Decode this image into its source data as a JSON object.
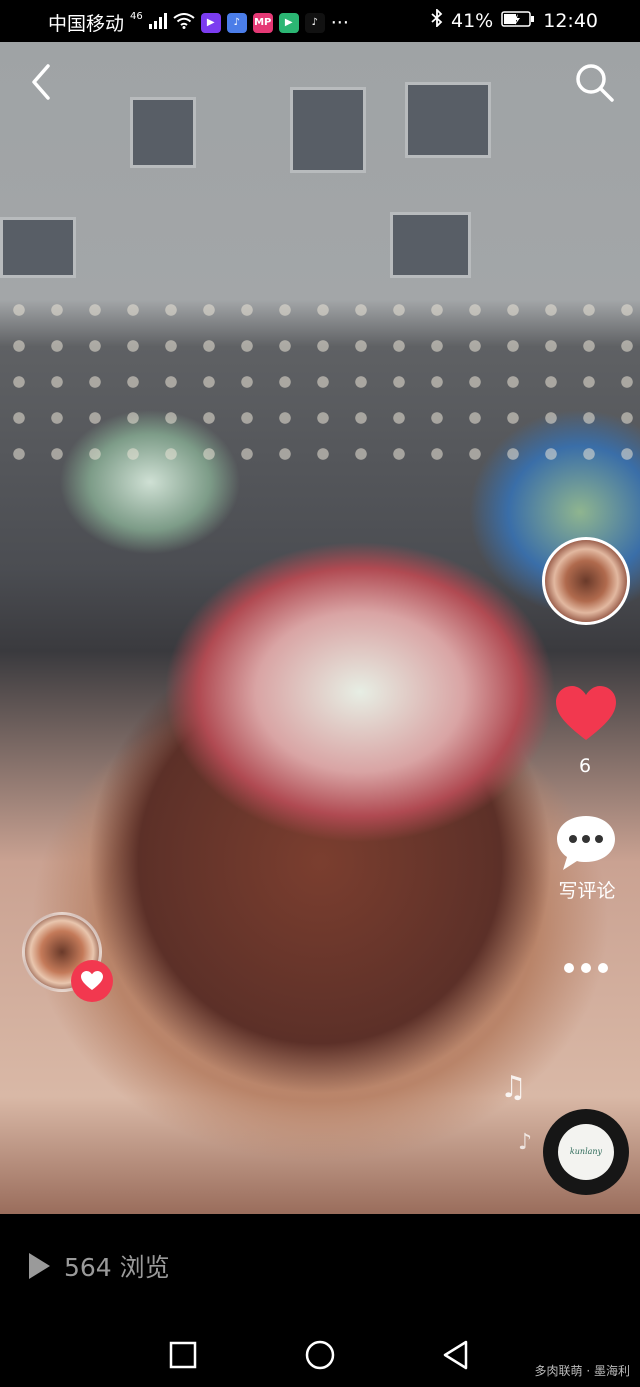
{
  "status_bar": {
    "carrier": "中国移动",
    "network": "46",
    "more": "···",
    "battery_percent": "41%",
    "time": "12:40",
    "app_icons": [
      "video-app-icon",
      "music-app-icon",
      "mp-app-icon",
      "play-app-icon",
      "tiktok-app-icon"
    ]
  },
  "video": {
    "like_count": "6",
    "comment_label": "写评论"
  },
  "music": {
    "disc_text": "kunlany"
  },
  "footer": {
    "views": "564 浏览"
  },
  "watermark": "多肉联萌 · 墨海利",
  "colors": {
    "like_red": "#f2384f",
    "background": "#000000",
    "muted_text": "#9a9a9a"
  }
}
